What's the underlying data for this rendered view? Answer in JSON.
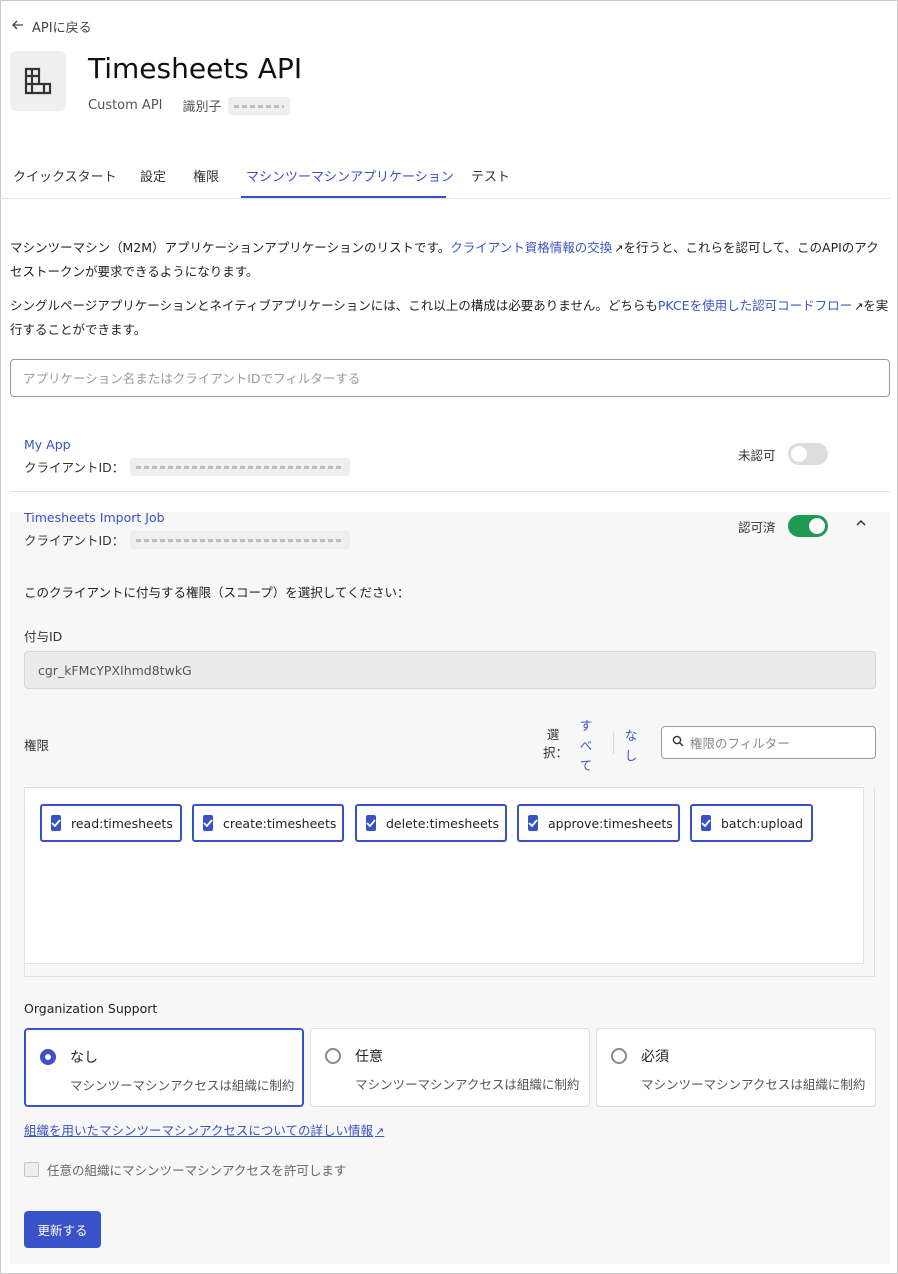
{
  "nav": {
    "back_label": "APIに戻る"
  },
  "api": {
    "name": "Timesheets API",
    "type": "Custom API",
    "identifier_label": "識別子"
  },
  "tabs": [
    {
      "label": "クイックスタート"
    },
    {
      "label": "設定"
    },
    {
      "label": "権限"
    },
    {
      "label": "マシンツーマシンアプリケーション",
      "active": true
    },
    {
      "label": "テスト"
    }
  ],
  "intro": {
    "p1_a": "マシンツーマシン（M2M）アプリケーションアプリケーションのリストです。",
    "p1_link": "クライアント資格情報の交換",
    "p1_b": "を行うと、これらを認可して、このAPIのアクセストークンが要求できるようになります。",
    "p2_a": "シングルページアプリケーションとネイティブアプリケーションには、これ以上の構成は必要ありません。どちらも",
    "p2_link": "PKCEを使用した認可コードフロー",
    "p2_b": "を実行することができます。"
  },
  "filter": {
    "placeholder": "アプリケーション名またはクライアントIDでフィルターする"
  },
  "apps": [
    {
      "name": "My App",
      "client_label": "クライアントID：",
      "status": "未認可",
      "authorized": false
    },
    {
      "name": "Timesheets Import Job",
      "client_label": "クライアントID：",
      "status": "認可済",
      "authorized": true
    }
  ],
  "detail": {
    "scope_prompt": "このクライアントに付与する権限（スコープ）を選択してください：",
    "grant_label": "付与ID",
    "grant_id": "cgr_kFMcYPXIhmd8twkG",
    "permissions_label": "権限",
    "select_label": "選択：",
    "select_all": "すべて",
    "select_none": "なし",
    "perm_filter_placeholder": "権限のフィルター",
    "scopes": [
      "read:timesheets",
      "create:timesheets",
      "delete:timesheets",
      "approve:timesheets",
      "batch:upload"
    ],
    "org_title": "Organization Support",
    "org_options": [
      {
        "title": "なし",
        "desc": "マシンツーマシンアクセスは組織に制約",
        "selected": true
      },
      {
        "title": "任意",
        "desc": "マシンツーマシンアクセスは組織に制約",
        "selected": false
      },
      {
        "title": "必須",
        "desc": "マシンツーマシンアクセスは組織に制約",
        "selected": false
      }
    ],
    "more_info_link": "組織を用いたマシンツーマシンアクセスについての詳しい情報",
    "allow_any_label": "任意の組織にマシンツーマシンアクセスを許可します",
    "update_button": "更新する"
  },
  "colors": {
    "accent": "#3a52c9",
    "toggle_on": "#1f9a55",
    "toggle_off": "#dcdcdc"
  }
}
